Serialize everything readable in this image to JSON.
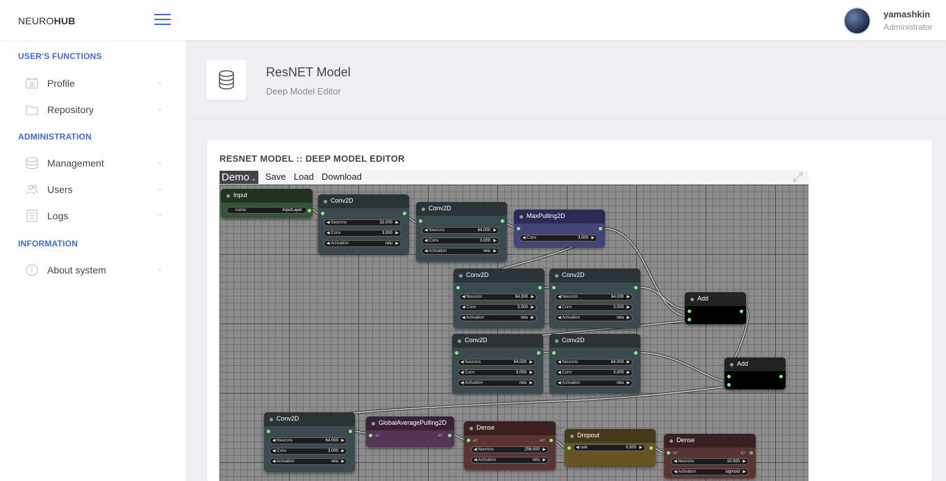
{
  "brand": {
    "normal": "NEURO",
    "bold": "HUB"
  },
  "user": {
    "name": "yamashkin",
    "role": "Administrator"
  },
  "sidebar": {
    "sections": [
      {
        "title": "USER'S FUNCTIONS"
      },
      {
        "title": "ADMINISTRATION"
      },
      {
        "title": "INFORMATION"
      }
    ],
    "items": [
      {
        "label": "Profile",
        "icon": "profile-icon"
      },
      {
        "label": "Repository",
        "icon": "folder-icon"
      },
      {
        "label": "Management",
        "icon": "database-icon"
      },
      {
        "label": "Users",
        "icon": "users-icon"
      },
      {
        "label": "Logs",
        "icon": "logs-icon"
      },
      {
        "label": "About system",
        "icon": "info-icon"
      }
    ]
  },
  "page": {
    "title": "ResNET Model",
    "subtitle": "Deep Model Editor",
    "icon": "database-icon"
  },
  "card": {
    "title": "RESNET MODEL :: DEEP MODEL EDITOR"
  },
  "toolbar": {
    "demo": "Demo",
    "save": "Save",
    "load": "Load",
    "download": "Download"
  },
  "colors": {
    "accent": "#3f6ad8",
    "slot": "#7cf37c"
  },
  "nodes": {
    "input": {
      "title": "Input",
      "w0": {
        "label": "name",
        "value": "InputLayer"
      }
    },
    "conv1": {
      "title": "Conv2D",
      "w0": {
        "label": "Neurons",
        "value": "32.000"
      },
      "w1": {
        "label": "Conv",
        "value": "3.000"
      },
      "w2": {
        "label": "Activation",
        "value": "relu"
      }
    },
    "conv2": {
      "title": "Conv2D",
      "w0": {
        "label": "Neurons",
        "value": "64.000"
      },
      "w1": {
        "label": "Conv",
        "value": "3.000"
      },
      "w2": {
        "label": "Activation",
        "value": "relu"
      }
    },
    "maxpool": {
      "title": "MaxPulling2D",
      "w0": {
        "label": "Conv",
        "value": "3.000"
      }
    },
    "conv3": {
      "title": "Conv2D",
      "w0": {
        "label": "Neurons",
        "value": "64.000"
      },
      "w1": {
        "label": "Conv",
        "value": "3.000"
      },
      "w2": {
        "label": "Activation",
        "value": "relu"
      }
    },
    "conv4": {
      "title": "Conv2D",
      "w0": {
        "label": "Neurons",
        "value": "64.000"
      },
      "w1": {
        "label": "Conv",
        "value": "3.000"
      },
      "w2": {
        "label": "Activation",
        "value": "relu"
      }
    },
    "add1": {
      "title": "Add"
    },
    "conv5": {
      "title": "Conv2D",
      "w0": {
        "label": "Neurons",
        "value": "64.000"
      },
      "w1": {
        "label": "Conv",
        "value": "3.000"
      },
      "w2": {
        "label": "Activation",
        "value": "relu"
      }
    },
    "conv6": {
      "title": "Conv2D",
      "w0": {
        "label": "Neurons",
        "value": "64.000"
      },
      "w1": {
        "label": "Conv",
        "value": "3.000"
      },
      "w2": {
        "label": "Activation",
        "value": "relu"
      }
    },
    "add2": {
      "title": "Add"
    },
    "conv7": {
      "title": "Conv2D",
      "w0": {
        "label": "Neurons",
        "value": "64.000"
      },
      "w1": {
        "label": "Conv",
        "value": "3.000"
      },
      "w2": {
        "label": "Activation",
        "value": "relu"
      }
    },
    "gap": {
      "title": "GlobalAveragePulling2D",
      "in_label": "arr",
      "out_label": "arr"
    },
    "dense1": {
      "title": "Dense",
      "in_label": "arr",
      "out_label": "arr",
      "w0": {
        "label": "Neurons",
        "value": "256.000"
      },
      "w1": {
        "label": "Activation",
        "value": "relu"
      }
    },
    "dropout": {
      "title": "Dropout",
      "w0": {
        "label": "rate",
        "value": "0.500"
      }
    },
    "dense2": {
      "title": "Dense",
      "in_label": "arr",
      "out_label": "arr",
      "w0": {
        "label": "Neurons",
        "value": "10.000"
      },
      "w1": {
        "label": "Activation",
        "value": "sigmoid"
      }
    }
  }
}
